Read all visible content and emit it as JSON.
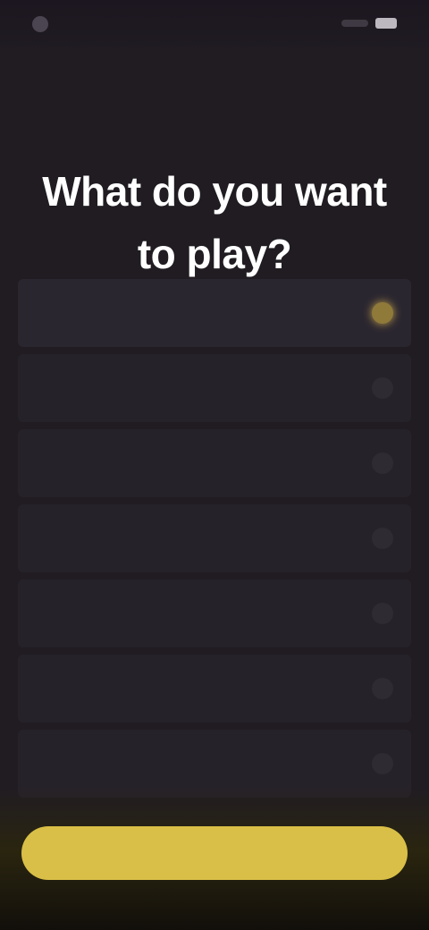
{
  "status_bar": {
    "time": "",
    "icons": [
      "app-logo-icon",
      "signal-icon",
      "battery-icon"
    ]
  },
  "top_bar": {
    "left_text": "",
    "right_text": ""
  },
  "page": {
    "title": "What do you want to play?"
  },
  "options": [
    {
      "label": "",
      "selected": true
    },
    {
      "label": "",
      "selected": false
    },
    {
      "label": "",
      "selected": false
    },
    {
      "label": "",
      "selected": false
    },
    {
      "label": "",
      "selected": false
    },
    {
      "label": "",
      "selected": false
    },
    {
      "label": "",
      "selected": false
    }
  ],
  "continue_button": {
    "label": ""
  },
  "colors": {
    "background": "#201c22",
    "option_background": "#262229",
    "accent": "#d9bf47",
    "selected_check": "#c7a44b"
  }
}
